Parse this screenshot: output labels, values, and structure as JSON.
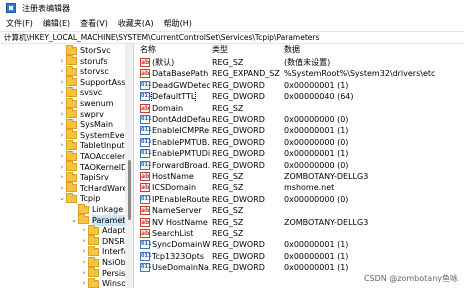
{
  "window": {
    "title": "注册表编辑器"
  },
  "menu": [
    "文件(F)",
    "编辑(E)",
    "查看(V)",
    "收藏夹(A)",
    "帮助(H)"
  ],
  "address": "计算机\\HKEY_LOCAL_MACHINE\\SYSTEM\\CurrentControlSet\\Services\\Tcpip\\Parameters",
  "tree": [
    {
      "label": "StorSvc",
      "depth": 0,
      "chev": ""
    },
    {
      "label": "storufs",
      "depth": 0,
      "chev": "›"
    },
    {
      "label": "storvsc",
      "depth": 0,
      "chev": "›"
    },
    {
      "label": "SupportAssis",
      "depth": 0,
      "chev": "›"
    },
    {
      "label": "svsvc",
      "depth": 0,
      "chev": "›"
    },
    {
      "label": "swenum",
      "depth": 0,
      "chev": "›"
    },
    {
      "label": "swprv",
      "depth": 0,
      "chev": "›"
    },
    {
      "label": "SysMain",
      "depth": 0,
      "chev": "›"
    },
    {
      "label": "SystemEvents",
      "depth": 0,
      "chev": "›"
    },
    {
      "label": "TabletInputSe",
      "depth": 0,
      "chev": "›"
    },
    {
      "label": "TAOAccelerat",
      "depth": 0,
      "chev": "›"
    },
    {
      "label": "TAOKernelDr",
      "depth": 0,
      "chev": "›"
    },
    {
      "label": "TapiSrv",
      "depth": 0,
      "chev": "›"
    },
    {
      "label": "TcHardWare",
      "depth": 0,
      "chev": "›"
    },
    {
      "label": "Tcpip",
      "depth": 0,
      "chev": "⌄"
    },
    {
      "label": "Linkage",
      "depth": 1,
      "chev": ""
    },
    {
      "label": "Parameters",
      "depth": 1,
      "chev": "⌄",
      "selected": true
    },
    {
      "label": "Adapter",
      "depth": 2,
      "chev": "›"
    },
    {
      "label": "DNSReg",
      "depth": 2,
      "chev": "›"
    },
    {
      "label": "Interfac",
      "depth": 2,
      "chev": "›"
    },
    {
      "label": "NsiObje",
      "depth": 2,
      "chev": "›"
    },
    {
      "label": "Persiste",
      "depth": 2,
      "chev": "›"
    },
    {
      "label": "Winsock",
      "depth": 2,
      "chev": "›"
    }
  ],
  "columns": {
    "name": "名称",
    "type": "类型",
    "data": "数据"
  },
  "rows": [
    {
      "icon": "ab",
      "name": "(默认)",
      "type": "REG_SZ",
      "data": "(数值未设置)"
    },
    {
      "icon": "ab",
      "name": "DataBasePath",
      "type": "REG_EXPAND_SZ",
      "data": "%SystemRoot%\\System32\\drivers\\etc"
    },
    {
      "icon": "bin",
      "name": "DeadGWDetec...",
      "type": "REG_DWORD",
      "data": "0x00000001 (1)"
    },
    {
      "icon": "bin",
      "name": "DefaultTTL",
      "type": "REG_DWORD",
      "data": "0x00000040 (64)",
      "selected": true
    },
    {
      "icon": "ab",
      "name": "Domain",
      "type": "REG_SZ",
      "data": ""
    },
    {
      "icon": "bin",
      "name": "DontAddDefau...",
      "type": "REG_DWORD",
      "data": "0x00000000 (0)"
    },
    {
      "icon": "bin",
      "name": "EnableICMPRe...",
      "type": "REG_DWORD",
      "data": "0x00000001 (1)"
    },
    {
      "icon": "bin",
      "name": "EnablePMTUB...",
      "type": "REG_DWORD",
      "data": "0x00000000 (0)"
    },
    {
      "icon": "bin",
      "name": "EnablePMTUDi...",
      "type": "REG_DWORD",
      "data": "0x00000001 (1)"
    },
    {
      "icon": "bin",
      "name": "ForwardBroad...",
      "type": "REG_DWORD",
      "data": "0x00000000 (0)"
    },
    {
      "icon": "ab",
      "name": "HostName",
      "type": "REG_SZ",
      "data": "ZOMBOTANY-DELLG3"
    },
    {
      "icon": "ab",
      "name": "ICSDomain",
      "type": "REG_SZ",
      "data": "mshome.net"
    },
    {
      "icon": "bin",
      "name": "IPEnableRouter",
      "type": "REG_DWORD",
      "data": "0x00000000 (0)"
    },
    {
      "icon": "ab",
      "name": "NameServer",
      "type": "REG_SZ",
      "data": ""
    },
    {
      "icon": "ab",
      "name": "NV HostName",
      "type": "REG_SZ",
      "data": "ZOMBOTANY-DELLG3"
    },
    {
      "icon": "ab",
      "name": "SearchList",
      "type": "REG_SZ",
      "data": ""
    },
    {
      "icon": "bin",
      "name": "SyncDomainWi...",
      "type": "REG_DWORD",
      "data": "0x00000001 (1)"
    },
    {
      "icon": "bin",
      "name": "Tcp1323Opts",
      "type": "REG_DWORD",
      "data": "0x00000001 (1)"
    },
    {
      "icon": "bin",
      "name": "UseDomainNa...",
      "type": "REG_DWORD",
      "data": "0x00000001 (1)"
    }
  ],
  "watermark": "CSDN @zombotany鱼咏"
}
